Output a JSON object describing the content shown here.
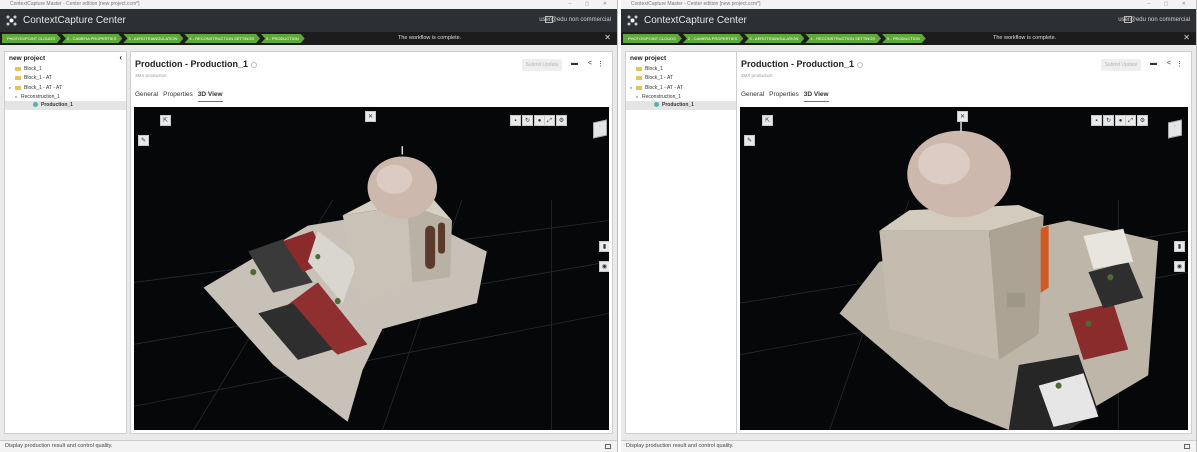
{
  "windows": [
    {
      "window_title": "ContextCapture Master - Center edition [new project.ccm*]",
      "app_name": "ContextCapture Center",
      "account": "user@edu non commercial",
      "workflow_steps": [
        "PHOTOS/POINT CLOUDS",
        "2 - CAMERA PROPERTIES",
        "3 - AEROTRIANGULATION",
        "4 - RECONSTRUCTION SETTINGS",
        "5 - PRODUCTION"
      ],
      "workflow_message": "The workflow is complete.",
      "workflow_close": "✕",
      "tree": {
        "title": "new project",
        "collapse": "‹",
        "items": [
          "Block_1",
          "Block_1 - AT",
          "Block_1 - AT - AT",
          "Reconstruction_1",
          "Production_1"
        ]
      },
      "panel": {
        "title": "Production - Production_1",
        "subtitle": "3MX production",
        "submit_label": "Submit Update",
        "tabs": [
          "General",
          "Properties",
          "3D View"
        ],
        "active_tab": "3D View"
      },
      "status": "Display production result and control quality."
    },
    {
      "window_title": "ContextCapture Master - Center edition [new project.ccm*]",
      "app_name": "ContextCapture Center",
      "account": "user@edu non commercial",
      "workflow_steps": [
        "PHOTOS/POINT CLOUDS",
        "2 - CAMERA PROPERTIES",
        "3 - AEROTRIANGULATION",
        "4 - RECONSTRUCTION SETTINGS",
        "5 - PRODUCTION"
      ],
      "workflow_message": "The workflow is complete.",
      "workflow_close": "✕",
      "tree": {
        "title": "new project",
        "collapse": "‹",
        "items": [
          "Block_1",
          "Block_1 - AT",
          "Block_1 - AT - AT",
          "Reconstruction_1",
          "Production_1"
        ]
      },
      "panel": {
        "title": "Production - Production_1",
        "subtitle": "3MX production",
        "submit_label": "Submit Update",
        "tabs": [
          "General",
          "Properties",
          "3D View"
        ],
        "active_tab": "3D View"
      },
      "status": "Display production result and control quality."
    }
  ],
  "viewer_icons": [
    "select-icon",
    "measure-icon",
    "navigate-icon",
    "layers-icon",
    "refresh-icon",
    "light-icon",
    "fullscreen-icon",
    "settings-icon",
    "view-cube-icon",
    "trash-icon",
    "location-icon"
  ],
  "viewer_background": "#050708",
  "workflow_accent": "#5ea83a"
}
